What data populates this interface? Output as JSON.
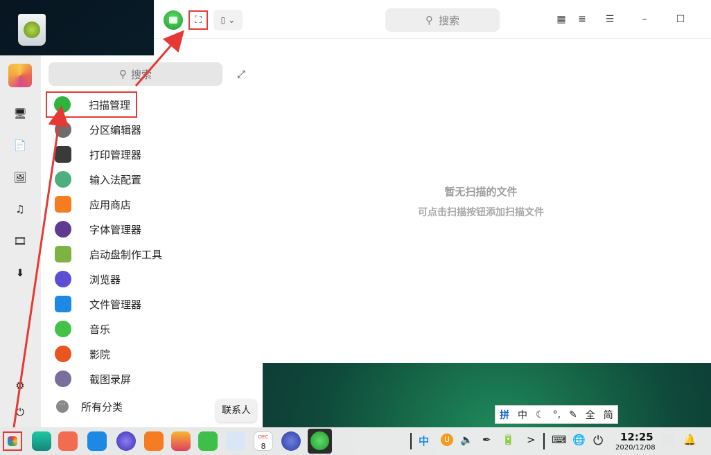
{
  "window": {
    "search_placeholder": "搜索",
    "empty_title": "暂无扫描的文件",
    "empty_subtitle": "可点击扫描按钮添加扫描文件",
    "scan_icon": "scan-icon",
    "device_icon": "scanner-device-icon",
    "view_icons": [
      "grid-view-icon",
      "list-view-icon",
      "menu-icon",
      "minimize-icon",
      "maximize-icon"
    ]
  },
  "launcher": {
    "search_placeholder": "搜索",
    "rail_icons": [
      "computer-icon",
      "document-icon",
      "picture-icon",
      "music-icon",
      "video-icon",
      "download-icon",
      "settings-icon",
      "power-icon"
    ],
    "apps": [
      {
        "label": "扫描管理",
        "color": "#2eb33e"
      },
      {
        "label": "分区编辑器",
        "color": "#6d6d6d"
      },
      {
        "label": "打印管理器",
        "color": "#3a3a3a"
      },
      {
        "label": "输入法配置",
        "color": "#4caf7d"
      },
      {
        "label": "应用商店",
        "color": "#f57c1f"
      },
      {
        "label": "字体管理器",
        "color": "#5e3b8e"
      },
      {
        "label": "启动盘制作工具",
        "color": "#7cb342"
      },
      {
        "label": "浏览器",
        "color": "#5c4fd6"
      },
      {
        "label": "文件管理器",
        "color": "#1e88e5"
      },
      {
        "label": "音乐",
        "color": "#43c24a"
      },
      {
        "label": "影院",
        "color": "#e8551f"
      },
      {
        "label": "截图录屏",
        "color": "#7a6f9c"
      }
    ],
    "all_categories": "所有分类"
  },
  "tooltip": "联系人",
  "ime": [
    "拼",
    "中",
    "☾",
    "°,",
    "✎",
    "全",
    "简"
  ],
  "taskbar": {
    "tray": [
      "中",
      "U",
      "🔈",
      "✒",
      "🔋",
      ">",
      "⌨",
      "🌐",
      "⏻"
    ],
    "time": "12:25",
    "date": "2020/12/08",
    "calendar_day": "8",
    "calendar_month": "DEC"
  }
}
